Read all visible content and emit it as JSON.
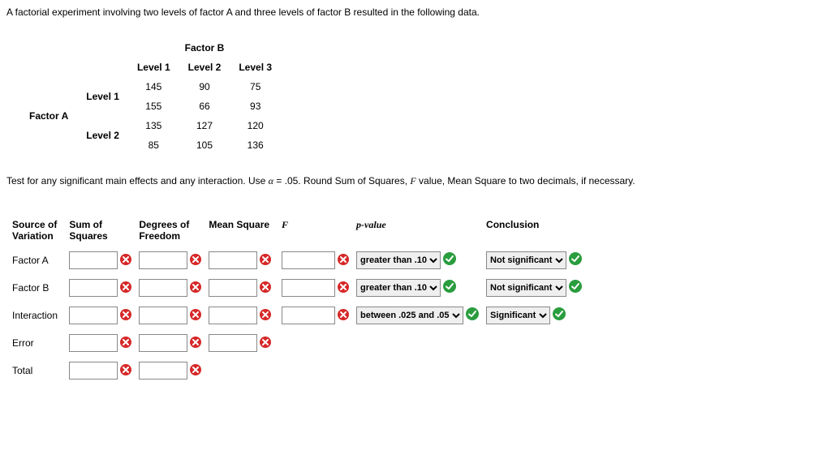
{
  "intro": "A factorial experiment involving two levels of factor A and three levels of factor B resulted in the following data.",
  "data_header_top": "Factor B",
  "data_cols": [
    "Level 1",
    "Level 2",
    "Level 3"
  ],
  "factorA_label": "Factor A",
  "rowA1": "Level 1",
  "rowA2": "Level 2",
  "vals": {
    "a1_r1": [
      "145",
      "90",
      "75"
    ],
    "a1_r2": [
      "155",
      "66",
      "93"
    ],
    "a2_r1": [
      "135",
      "127",
      "120"
    ],
    "a2_r2": [
      "85",
      "105",
      "136"
    ]
  },
  "instruct_pre": "Test for any significant main effects and any interaction. Use ",
  "alpha_sym": "α",
  "instruct_eq": " = .05. Round Sum of Squares, ",
  "f_ital": "F",
  "instruct_post": " value, Mean Square to two decimals, if necessary.",
  "cols": {
    "source1": "Source of",
    "source2": "Variation",
    "ss1": "Sum of",
    "ss2": "Squares",
    "df1": "Degrees of",
    "df2": "Freedom",
    "ms": "Mean Square",
    "f": "F",
    "pv": "p-value",
    "concl": "Conclusion"
  },
  "rows": {
    "a": "Factor A",
    "b": "Factor B",
    "int": "Interaction",
    "err": "Error",
    "tot": "Total"
  },
  "pvalue_opts": {
    "gt10": "greater than .10",
    "btw": "between .025 and .05"
  },
  "concl_opts": {
    "ns": "Not significant",
    "sig": "Significant"
  }
}
